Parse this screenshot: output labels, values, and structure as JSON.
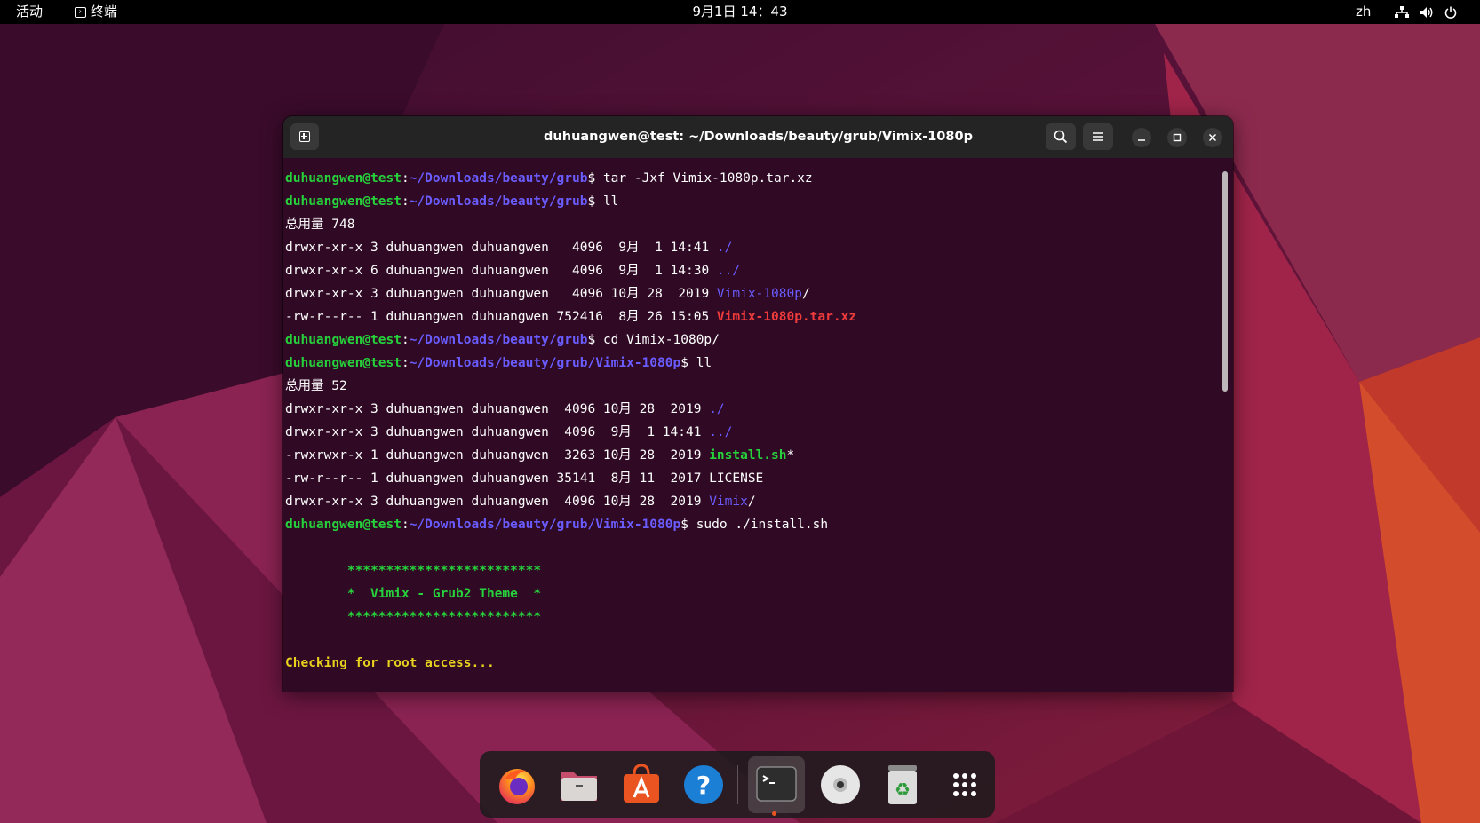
{
  "topbar": {
    "activities": "活动",
    "app_name": "终端",
    "clock": "9月1日 14：43",
    "language": "zh"
  },
  "terminal": {
    "title": "duhuangwen@test: ~/Downloads/beauty/grub/Vimix-1080p",
    "buttons": [
      "new-tab",
      "search",
      "menu",
      "minimize",
      "maximize",
      "close"
    ],
    "prompt_user": "duhuangwen@test",
    "lines": [
      {
        "path": "~/Downloads/beauty/grub",
        "cmd": " tar -Jxf Vimix-1080p.tar.xz"
      },
      {
        "path": "~/Downloads/beauty/grub",
        "cmd": " ll"
      },
      {
        "text": "总用量 748"
      },
      {
        "text": "drwxr-xr-x 3 duhuangwen duhuangwen   4096  9月  1 14:41 ",
        "name": "./"
      },
      {
        "text": "drwxr-xr-x 6 duhuangwen duhuangwen   4096  9月  1 14:30 ",
        "name": "../"
      },
      {
        "text": "drwxr-xr-x 3 duhuangwen duhuangwen   4096 10月 28  2019 ",
        "name": "Vimix-1080p",
        "suffix": "/"
      },
      {
        "text": "-rw-r--r-- 1 duhuangwen duhuangwen 752416  8月 26 15:05 ",
        "name": "Vimix-1080p.tar.xz"
      },
      {
        "path": "~/Downloads/beauty/grub",
        "cmd": " cd Vimix-1080p/"
      },
      {
        "path": "~/Downloads/beauty/grub/Vimix-1080p",
        "cmd": " ll"
      },
      {
        "text": "总用量 52"
      },
      {
        "text": "drwxr-xr-x 3 duhuangwen duhuangwen  4096 10月 28  2019 ",
        "name": "./"
      },
      {
        "text": "drwxr-xr-x 3 duhuangwen duhuangwen  4096  9月  1 14:41 ",
        "name": "../"
      },
      {
        "text": "-rwxrwxr-x 1 duhuangwen duhuangwen  3263 10月 28  2019 ",
        "name": "install.sh",
        "suffix": "*"
      },
      {
        "text": "-rw-r--r-- 1 duhuangwen duhuangwen 35141  8月 11  2017 LICENSE"
      },
      {
        "text": "drwxr-xr-x 3 duhuangwen duhuangwen  4096 10月 28  2019 ",
        "name": "Vimix",
        "suffix": "/"
      },
      {
        "path": "~/Downloads/beauty/grub/Vimix-1080p",
        "cmd": " sudo ./install.sh"
      },
      {
        "text": ""
      },
      {
        "banner": "        *************************"
      },
      {
        "banner": "        *  Vimix - Grub2 Theme  *"
      },
      {
        "banner": "        *************************"
      },
      {
        "text": ""
      },
      {
        "status": "Checking for root access..."
      }
    ]
  },
  "dock": {
    "apps": [
      "Firefox",
      "Files",
      "Ubuntu Software",
      "Help",
      "Terminal",
      "Disc",
      "Trash",
      "Show Applications"
    ]
  },
  "colors": {
    "terminal_bg": "#300a24",
    "prompt_user": "#26d13b",
    "prompt_path": "#6a5cff",
    "archive": "#ef3b3b",
    "status": "#e8d21d"
  }
}
